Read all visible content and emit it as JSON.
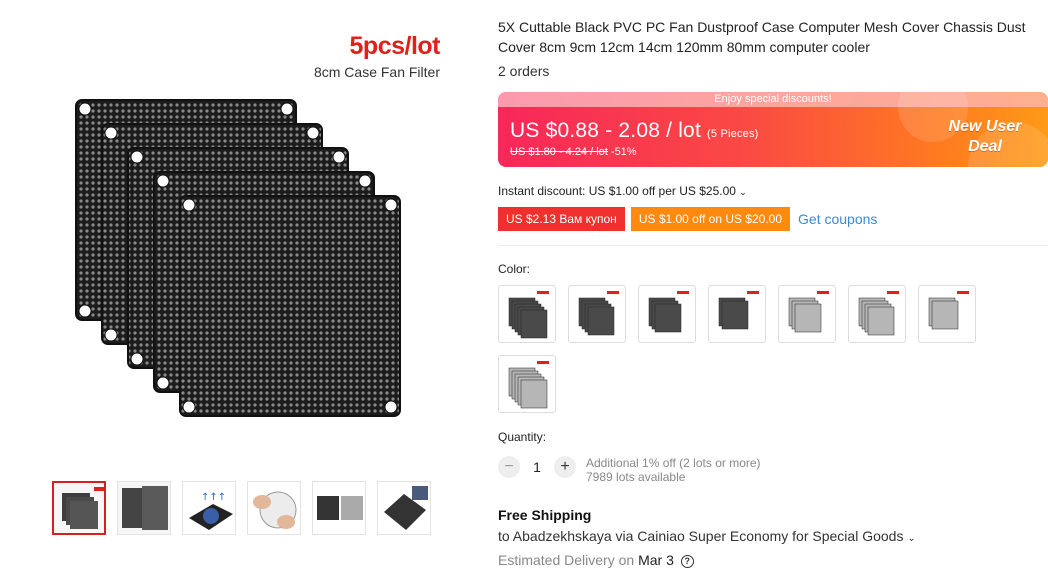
{
  "gallery": {
    "promo_title": "5pcs/lot",
    "promo_subtitle": "8cm Case Fan Filter",
    "thumbnails": [
      {
        "name": "filter-stack-black"
      },
      {
        "name": "filter-stack-black-pair"
      },
      {
        "name": "fan-with-filter"
      },
      {
        "name": "filter-in-hand"
      },
      {
        "name": "filters-black-and-gray"
      },
      {
        "name": "filter-on-fan"
      }
    ]
  },
  "product": {
    "title": "5X Cuttable Black PVC PC Fan Dustproof Case Computer Mesh Cover Chassis Dust Cover 8cm 9cm 12cm 14cm 120mm 80mm computer cooler",
    "orders": "2 orders"
  },
  "price": {
    "banner_strip": "Enjoy special discounts!",
    "current": "US $0.88 - 2.08 / lot",
    "pieces": "(5 Pieces)",
    "original": "US $1.80 - 4.24 / lot",
    "discount": "-51%",
    "badge": "New User Deal"
  },
  "discounts": {
    "instant": "Instant discount: US $1.00 off per US $25.00",
    "coupon1": "US $2.13 Вам купон",
    "coupon2": "US $1.00 off on US $20.00",
    "get_coupons": "Get coupons"
  },
  "color": {
    "label": "Color:",
    "options": [
      {
        "shade": "#4a4a4a",
        "count": 5
      },
      {
        "shade": "#4a4a4a",
        "count": 4
      },
      {
        "shade": "#4a4a4a",
        "count": 3
      },
      {
        "shade": "#4a4a4a",
        "count": 2
      },
      {
        "shade": "#b6b6b6",
        "count": 3
      },
      {
        "shade": "#b6b6b6",
        "count": 4
      },
      {
        "shade": "#b6b6b6",
        "count": 2
      },
      {
        "shade": "#b6b6b6",
        "count": 5
      }
    ]
  },
  "quantity": {
    "label": "Quantity:",
    "value": "1",
    "minus": "−",
    "plus": "+",
    "note": "Additional 1% off (2 lots or more)",
    "available": "7989 lots available"
  },
  "shipping": {
    "title": "Free Shipping",
    "to": "to Abadzekhskaya via Cainiao Super Economy for Special Goods",
    "eta_prefix": "Estimated Delivery on",
    "eta_date": "Mar 3"
  },
  "colors": {
    "accent_red": "#e0201b",
    "link_blue": "#3b8bd1",
    "coupon_red": "#f0302d",
    "coupon_orange": "#ff8a0f"
  }
}
